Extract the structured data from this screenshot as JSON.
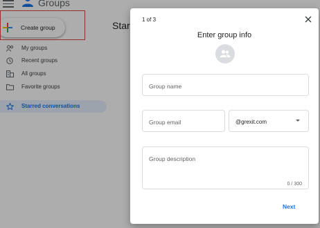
{
  "header": {
    "title": "Groups",
    "menu_icon": "menu-icon",
    "logo_icon": "groups-logo-icon"
  },
  "sidebar": {
    "create_button": {
      "label": "Create group",
      "icon": "plus-icon"
    },
    "items": [
      {
        "label": "My groups",
        "icon": "people-icon"
      },
      {
        "label": "Recent groups",
        "icon": "clock-icon"
      },
      {
        "label": "All groups",
        "icon": "building-icon"
      },
      {
        "label": "Favorite groups",
        "icon": "folder-icon"
      },
      {
        "label": "Starred conversations",
        "icon": "star-icon",
        "active": true
      }
    ]
  },
  "main": {
    "title": "Starr"
  },
  "dialog": {
    "step": "1 of 3",
    "title": "Enter group info",
    "avatar_icon": "group-avatar-icon",
    "close_icon": "close-icon",
    "fields": {
      "name": {
        "placeholder": "Group name",
        "value": ""
      },
      "email": {
        "placeholder": "Group email",
        "value": ""
      },
      "domain": {
        "selected": "@grexit.com"
      },
      "description": {
        "placeholder": "Group description",
        "value": "",
        "counter": "0 / 300"
      }
    },
    "next_label": "Next"
  },
  "colors": {
    "accent": "#1a73e8",
    "highlight_border": "#e0483d",
    "active_bg": "#e8f0fe"
  }
}
